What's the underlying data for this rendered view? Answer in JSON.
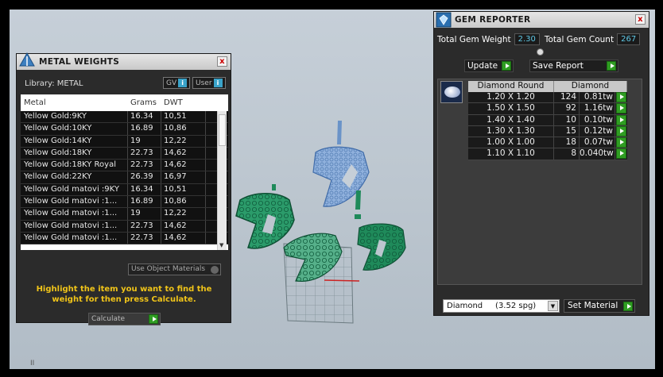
{
  "metal_panel": {
    "title": "METAL WEIGHTS",
    "close": "x",
    "library_label": "Library: METAL",
    "chip_gv": "GV",
    "chip_user": "User",
    "chip_info": "i",
    "columns": [
      "Metal",
      "Grams",
      "DWT"
    ],
    "rows": [
      [
        "Yellow Gold:9KY",
        "16.34",
        "10,51"
      ],
      [
        "Yellow Gold:10KY",
        "16.89",
        "10,86"
      ],
      [
        "Yellow Gold:14KY",
        "19",
        "12,22"
      ],
      [
        "Yellow Gold:18KY",
        "22.73",
        "14,62"
      ],
      [
        "Yellow Gold:18KY Royal",
        "22.73",
        "14,62"
      ],
      [
        "Yellow Gold:22KY",
        "26.39",
        "16,97"
      ],
      [
        "Yellow Gold matovi :9KY",
        "16.34",
        "10,51"
      ],
      [
        "Yellow Gold matovi :1...",
        "16.89",
        "10,86"
      ],
      [
        "Yellow Gold matovi :1...",
        "19",
        "12,22"
      ],
      [
        "Yellow Gold matovi :1...",
        "22.73",
        "14,62"
      ],
      [
        "Yellow Gold matovi :1...",
        "22.73",
        "14,62"
      ]
    ],
    "use_object_materials": "Use Object Materials",
    "hint": "Highlight the item you want to find the weight for then press Calculate.",
    "calculate": "Calculate"
  },
  "gem_panel": {
    "title": "GEM REPORTER",
    "close": "x",
    "total_weight_label": "Total Gem Weight",
    "total_weight_value": "2.30",
    "total_count_label": "Total Gem Count",
    "total_count_value": "267",
    "update": "Update",
    "save_report": "Save Report",
    "table_header": [
      "Diamond Round",
      "Diamond"
    ],
    "rows": [
      [
        "1.20 X 1.20",
        "124",
        "0.81tw"
      ],
      [
        "1.50 X 1.50",
        "92",
        "1.16tw"
      ],
      [
        "1.40 X 1.40",
        "10",
        "0.10tw"
      ],
      [
        "1.30 X 1.30",
        "15",
        "0.12tw"
      ],
      [
        "1.00 X 1.00",
        "18",
        "0.07tw"
      ],
      [
        "1.10 X 1.10",
        "8",
        "0.040tw"
      ]
    ],
    "material_select": "Diamond     (3.52 spg)",
    "set_material": "Set Material"
  },
  "viewport": {
    "corner_mark": "II"
  },
  "colors": {
    "accent_green": "#2f9d22",
    "value_blue": "#5fc8e6",
    "hint_yellow": "#f0c419",
    "model_green": "#1f8a5a",
    "model_blue": "#6a93c8"
  }
}
